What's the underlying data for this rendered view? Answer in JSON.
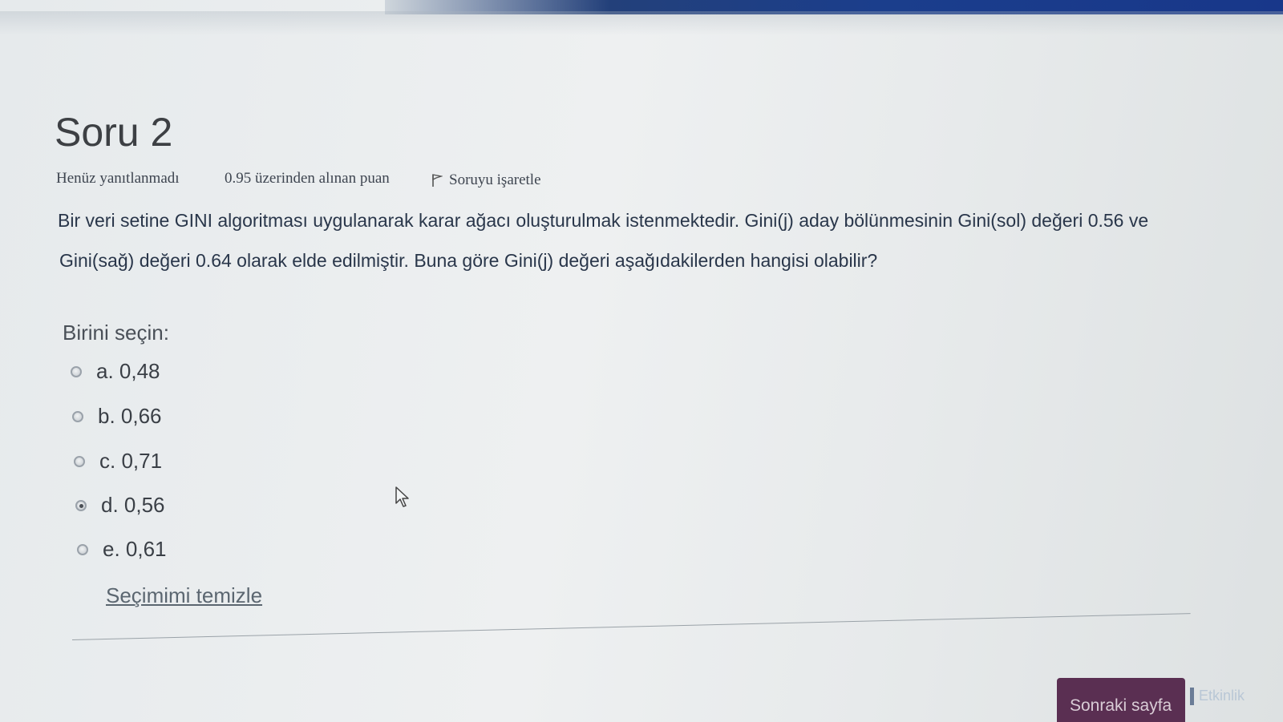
{
  "question": {
    "title": "Soru 2",
    "state": "Henüz yanıtlanmadı",
    "grade": "0.95 üzerinden alınan puan",
    "flag_label": "Soruyu işaretle",
    "text_line1": "Bir veri setine GINI algoritması uygulanarak karar ağacı oluşturulmak istenmektedir. Gini(j) aday bölünmesinin Gini(sol) değeri 0.56 ve",
    "text_line2": "Gini(sağ) değeri 0.64 olarak elde edilmiştir. Buna göre Gini(j) değeri aşağıdakilerden hangisi olabilir?",
    "prompt": "Birini seçin:",
    "options": [
      {
        "label": "a. 0,48",
        "selected": false
      },
      {
        "label": "b. 0,66",
        "selected": false
      },
      {
        "label": "c. 0,71",
        "selected": false
      },
      {
        "label": "d. 0,56",
        "selected": true
      },
      {
        "label": "e. 0,61",
        "selected": false
      }
    ],
    "clear_label": "Seçimimi temizle"
  },
  "footer": {
    "next_label": "Sonraki sayfa",
    "partial_label": "Etkinlik"
  },
  "colors": {
    "next_button": "#5a2f52",
    "top_band": "#1b3e8c"
  },
  "icons": [
    "flag-icon",
    "mouse-cursor-icon"
  ]
}
